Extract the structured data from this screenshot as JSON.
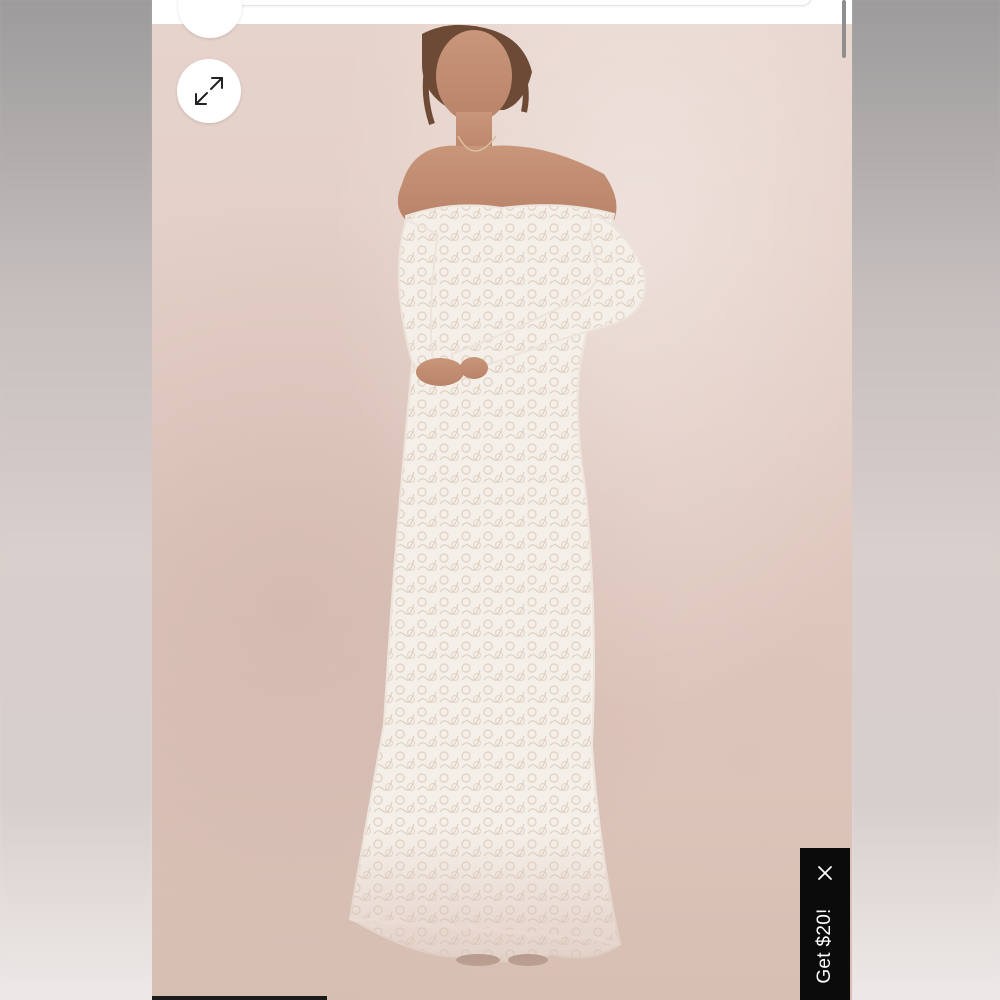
{
  "screen": {
    "background_color": "#ffffff"
  },
  "product_image": {
    "backdrop_color": "#e2cdc4"
  },
  "controls": {
    "partial_button_icon": "circle-button",
    "expand_button_icon": "expand-arrows-icon"
  },
  "promo": {
    "label": "Get $20!",
    "close_icon": "close-icon",
    "background_color": "#0b0b0b",
    "text_color": "#ffffff"
  }
}
